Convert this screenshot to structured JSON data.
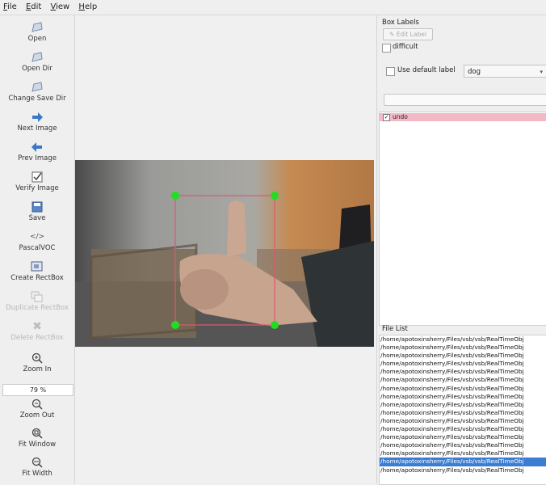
{
  "menu": [
    "File",
    "Edit",
    "View",
    "Help"
  ],
  "tools": [
    {
      "label": "Open",
      "icon": "open-file-icon",
      "enabled": true
    },
    {
      "label": "Open Dir",
      "icon": "open-dir-icon",
      "enabled": true
    },
    {
      "label": "Change Save Dir",
      "icon": "change-save-dir-icon",
      "enabled": true
    },
    {
      "label": "Next Image",
      "icon": "next-arrow-icon",
      "enabled": true
    },
    {
      "label": "Prev Image",
      "icon": "prev-arrow-icon",
      "enabled": true
    },
    {
      "label": "Verify Image",
      "icon": "verify-icon",
      "enabled": true
    },
    {
      "label": "Save",
      "icon": "save-icon",
      "enabled": true
    },
    {
      "label": "PascalVOC",
      "icon": "format-code-icon",
      "enabled": true
    },
    {
      "label": "Create RectBox",
      "icon": "create-rect-icon",
      "enabled": true
    },
    {
      "label": "Duplicate RectBox",
      "icon": "duplicate-icon",
      "enabled": false
    },
    {
      "label": "Delete RectBox",
      "icon": "delete-icon",
      "enabled": false
    },
    {
      "label": "Zoom In",
      "icon": "zoom-in-icon",
      "enabled": true
    },
    {
      "label": "Zoom Out",
      "icon": "zoom-out-icon",
      "enabled": true
    },
    {
      "label": "Fit Window",
      "icon": "fit-window-icon",
      "enabled": true
    },
    {
      "label": "Fit Width",
      "icon": "fit-width-icon",
      "enabled": true
    }
  ],
  "zoom": {
    "value": "79 %"
  },
  "box_labels": {
    "title": "Box Labels",
    "edit_label": "Edit Label",
    "difficult": "difficult",
    "use_default_label": "Use default label",
    "default_label": "dog",
    "labels": [
      {
        "text": "undo",
        "checked": true,
        "color": "#f3b9c6"
      }
    ]
  },
  "file_list": {
    "title": "File List",
    "selected_index": 15,
    "items": [
      "/home/apotoxinsherry/Files/vsb/vsb/RealTimeObj",
      "/home/apotoxinsherry/Files/vsb/vsb/RealTimeObj",
      "/home/apotoxinsherry/Files/vsb/vsb/RealTimeObj",
      "/home/apotoxinsherry/Files/vsb/vsb/RealTimeObj",
      "/home/apotoxinsherry/Files/vsb/vsb/RealTimeObj",
      "/home/apotoxinsherry/Files/vsb/vsb/RealTimeObj",
      "/home/apotoxinsherry/Files/vsb/vsb/RealTimeObj",
      "/home/apotoxinsherry/Files/vsb/vsb/RealTimeObj",
      "/home/apotoxinsherry/Files/vsb/vsb/RealTimeObj",
      "/home/apotoxinsherry/Files/vsb/vsb/RealTimeObj",
      "/home/apotoxinsherry/Files/vsb/vsb/RealTimeObj",
      "/home/apotoxinsherry/Files/vsb/vsb/RealTimeObj",
      "/home/apotoxinsherry/Files/vsb/vsb/RealTimeObj",
      "/home/apotoxinsherry/Files/vsb/vsb/RealTimeObj",
      "/home/apotoxinsherry/Files/vsb/vsb/RealTimeObj",
      "/home/apotoxinsherry/Files/vsb/vsb/RealTimeObj",
      "/home/apotoxinsherry/Files/vsb/vsb/RealTimeObj"
    ]
  },
  "colors": {
    "bbox": "#e0566f",
    "handle": "#22dd22",
    "selection": "#3a7dd3"
  }
}
